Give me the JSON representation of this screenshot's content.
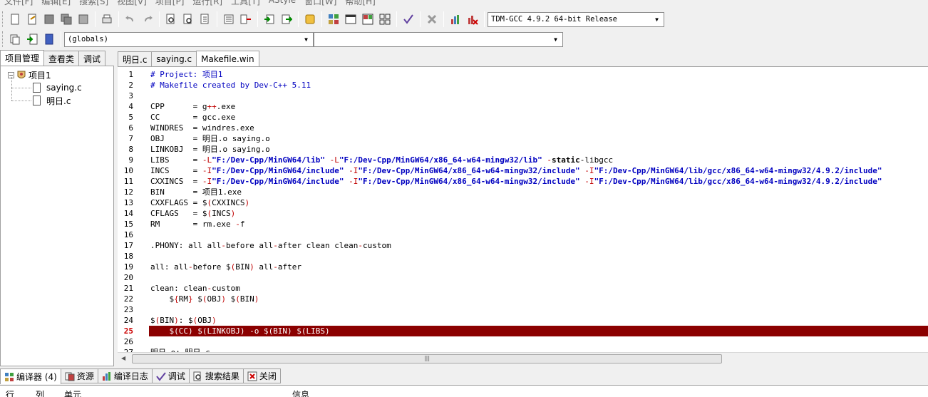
{
  "menu": [
    "文件[F]",
    "编辑[E]",
    "搜索[S]",
    "视图[V]",
    "项目[P]",
    "运行[R]",
    "工具[T]",
    "AStyle",
    "窗口[W]",
    "帮助[H]"
  ],
  "compiler_select": "TDM-GCC 4.9.2 64-bit Release",
  "scope_select": "(globals)",
  "symbol_select": "",
  "left_tabs": [
    "项目管理",
    "查看类",
    "调试"
  ],
  "project_tree": {
    "root": "项目1",
    "files": [
      "saying.c",
      "明日.c"
    ]
  },
  "editor_tabs": [
    "明日.c",
    "saying.c",
    "Makefile.win"
  ],
  "code_lines": [
    {
      "n": "1",
      "parts": [
        {
          "t": "# Project: 项目1",
          "c": "c-comment"
        }
      ]
    },
    {
      "n": "2",
      "parts": [
        {
          "t": "# Makefile created by Dev-C++ 5.11",
          "c": "c-comment"
        }
      ]
    },
    {
      "n": "3",
      "parts": []
    },
    {
      "n": "4",
      "parts": [
        {
          "t": "CPP      = g",
          "c": "c-plain"
        },
        {
          "t": "++",
          "c": "c-sym"
        },
        {
          "t": ".exe",
          "c": "c-plain"
        }
      ]
    },
    {
      "n": "5",
      "parts": [
        {
          "t": "CC       = gcc.exe",
          "c": "c-plain"
        }
      ]
    },
    {
      "n": "6",
      "parts": [
        {
          "t": "WINDRES  = windres.exe",
          "c": "c-plain"
        }
      ]
    },
    {
      "n": "7",
      "parts": [
        {
          "t": "OBJ      = 明日.o saying.o",
          "c": "c-plain"
        }
      ]
    },
    {
      "n": "8",
      "parts": [
        {
          "t": "LINKOBJ  = 明日.o saying.o",
          "c": "c-plain"
        }
      ]
    },
    {
      "n": "9",
      "parts": [
        {
          "t": "LIBS     = ",
          "c": "c-plain"
        },
        {
          "t": "-L",
          "c": "c-sym"
        },
        {
          "t": "\"F:/Dev-Cpp/MinGW64/lib\"",
          "c": "c-str"
        },
        {
          "t": " -L",
          "c": "c-sym"
        },
        {
          "t": "\"F:/Dev-Cpp/MinGW64/x86_64-w64-mingw32/lib\"",
          "c": "c-str"
        },
        {
          "t": " -",
          "c": "c-sym"
        },
        {
          "t": "static",
          "c": "c-kw"
        },
        {
          "t": "-libgcc",
          "c": "c-plain"
        }
      ]
    },
    {
      "n": "10",
      "parts": [
        {
          "t": "INCS     = ",
          "c": "c-plain"
        },
        {
          "t": "-I",
          "c": "c-sym"
        },
        {
          "t": "\"F:/Dev-Cpp/MinGW64/include\"",
          "c": "c-str"
        },
        {
          "t": " -I",
          "c": "c-sym"
        },
        {
          "t": "\"F:/Dev-Cpp/MinGW64/x86_64-w64-mingw32/include\"",
          "c": "c-str"
        },
        {
          "t": " -I",
          "c": "c-sym"
        },
        {
          "t": "\"F:/Dev-Cpp/MinGW64/lib/gcc/x86_64-w64-mingw32/4.9.2/include\"",
          "c": "c-str"
        }
      ]
    },
    {
      "n": "11",
      "parts": [
        {
          "t": "CXXINCS  = ",
          "c": "c-plain"
        },
        {
          "t": "-I",
          "c": "c-sym"
        },
        {
          "t": "\"F:/Dev-Cpp/MinGW64/include\"",
          "c": "c-str"
        },
        {
          "t": " -I",
          "c": "c-sym"
        },
        {
          "t": "\"F:/Dev-Cpp/MinGW64/x86_64-w64-mingw32/include\"",
          "c": "c-str"
        },
        {
          "t": " -I",
          "c": "c-sym"
        },
        {
          "t": "\"F:/Dev-Cpp/MinGW64/lib/gcc/x86_64-w64-mingw32/4.9.2/include\"",
          "c": "c-str"
        }
      ]
    },
    {
      "n": "12",
      "parts": [
        {
          "t": "BIN      = 项目1.exe",
          "c": "c-plain"
        }
      ]
    },
    {
      "n": "13",
      "parts": [
        {
          "t": "CXXFLAGS = $",
          "c": "c-plain"
        },
        {
          "t": "(",
          "c": "c-sym"
        },
        {
          "t": "CXXINCS",
          "c": "c-plain"
        },
        {
          "t": ")",
          "c": "c-sym"
        }
      ]
    },
    {
      "n": "14",
      "parts": [
        {
          "t": "CFLAGS   = $",
          "c": "c-plain"
        },
        {
          "t": "(",
          "c": "c-sym"
        },
        {
          "t": "INCS",
          "c": "c-plain"
        },
        {
          "t": ")",
          "c": "c-sym"
        }
      ]
    },
    {
      "n": "15",
      "parts": [
        {
          "t": "RM       = rm.exe ",
          "c": "c-plain"
        },
        {
          "t": "-",
          "c": "c-sym"
        },
        {
          "t": "f",
          "c": "c-plain"
        }
      ]
    },
    {
      "n": "16",
      "parts": []
    },
    {
      "n": "17",
      "parts": [
        {
          "t": ".PHONY: all all",
          "c": "c-plain"
        },
        {
          "t": "-",
          "c": "c-sym"
        },
        {
          "t": "before all",
          "c": "c-plain"
        },
        {
          "t": "-",
          "c": "c-sym"
        },
        {
          "t": "after clean clean",
          "c": "c-plain"
        },
        {
          "t": "-",
          "c": "c-sym"
        },
        {
          "t": "custom",
          "c": "c-plain"
        }
      ]
    },
    {
      "n": "18",
      "parts": []
    },
    {
      "n": "19",
      "parts": [
        {
          "t": "all: all",
          "c": "c-plain"
        },
        {
          "t": "-",
          "c": "c-sym"
        },
        {
          "t": "before $",
          "c": "c-plain"
        },
        {
          "t": "(",
          "c": "c-sym"
        },
        {
          "t": "BIN",
          "c": "c-plain"
        },
        {
          "t": ")",
          "c": "c-sym"
        },
        {
          "t": " all",
          "c": "c-plain"
        },
        {
          "t": "-",
          "c": "c-sym"
        },
        {
          "t": "after",
          "c": "c-plain"
        }
      ]
    },
    {
      "n": "20",
      "parts": []
    },
    {
      "n": "21",
      "parts": [
        {
          "t": "clean: clean",
          "c": "c-plain"
        },
        {
          "t": "-",
          "c": "c-sym"
        },
        {
          "t": "custom",
          "c": "c-plain"
        }
      ]
    },
    {
      "n": "22",
      "parts": [
        {
          "t": "    $",
          "c": "c-plain"
        },
        {
          "t": "{",
          "c": "c-sym"
        },
        {
          "t": "RM",
          "c": "c-plain"
        },
        {
          "t": "}",
          "c": "c-sym"
        },
        {
          "t": " $",
          "c": "c-plain"
        },
        {
          "t": "(",
          "c": "c-sym"
        },
        {
          "t": "OBJ",
          "c": "c-plain"
        },
        {
          "t": ")",
          "c": "c-sym"
        },
        {
          "t": " $",
          "c": "c-plain"
        },
        {
          "t": "(",
          "c": "c-sym"
        },
        {
          "t": "BIN",
          "c": "c-plain"
        },
        {
          "t": ")",
          "c": "c-sym"
        }
      ]
    },
    {
      "n": "23",
      "parts": []
    },
    {
      "n": "24",
      "parts": [
        {
          "t": "$",
          "c": "c-plain"
        },
        {
          "t": "(",
          "c": "c-sym"
        },
        {
          "t": "BIN",
          "c": "c-plain"
        },
        {
          "t": ")",
          "c": "c-sym"
        },
        {
          "t": ": $",
          "c": "c-plain"
        },
        {
          "t": "(",
          "c": "c-sym"
        },
        {
          "t": "OBJ",
          "c": "c-plain"
        },
        {
          "t": ")",
          "c": "c-sym"
        }
      ]
    },
    {
      "n": "25",
      "hl": true,
      "parts": [
        {
          "t": "    $(CC) $(LINKOBJ) -o $(BIN) $(LIBS)",
          "c": "c-plain"
        }
      ]
    },
    {
      "n": "26",
      "parts": []
    },
    {
      "n": "27",
      "parts": [
        {
          "t": "明日.o: 明日.c",
          "c": "c-plain"
        }
      ]
    }
  ],
  "bottom_tabs": [
    {
      "label": "编译器 (4)",
      "icon": "grid-icon"
    },
    {
      "label": "资源",
      "icon": "resource-icon"
    },
    {
      "label": "编译日志",
      "icon": "chart-icon"
    },
    {
      "label": "调试",
      "icon": "check-icon"
    },
    {
      "label": "搜索结果",
      "icon": "search-icon"
    },
    {
      "label": "关闭",
      "icon": "close-icon"
    }
  ],
  "bottom_columns": [
    "行",
    "列",
    "单元",
    "信息"
  ],
  "colors": {
    "highlight": "#8b0000",
    "string": "#0000c0",
    "symbol": "#c00000"
  }
}
